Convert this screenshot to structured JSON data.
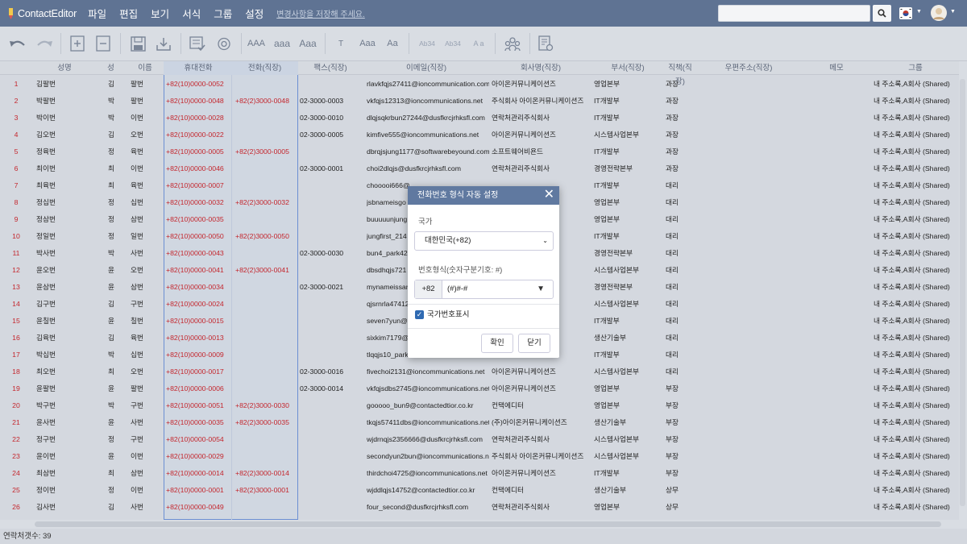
{
  "app": {
    "title": "ContactEditor",
    "warning": "변경사항을 저장해 주세요."
  },
  "menu": [
    "파일",
    "편집",
    "보기",
    "서식",
    "그룹",
    "설정"
  ],
  "search": {
    "placeholder": ""
  },
  "toolbar": {
    "font_upper": "AAA",
    "font_lower": "aaa",
    "font_title": "Aaa",
    "tt": "T",
    "aa1": "Aaa",
    "aa2": "Aa",
    "ab1": "Ab34",
    "ab2": "Ab34",
    "ab3": "A a"
  },
  "columns": [
    "성명",
    "성",
    "이름",
    "휴대전화",
    "전화(직장)",
    "팩스(직장)",
    "이메일(직장)",
    "회사명(직장)",
    "부서(직장)",
    "직책(직장)",
    "우편주소(직장)",
    "메모",
    "그룹"
  ],
  "rows": [
    {
      "n": "1",
      "name": "김팔번",
      "last": "김",
      "first": "팔번",
      "mobile": "+82(10)0000-0052",
      "work": "",
      "fax": "",
      "email": "rlavkfqjs27411@ioncommunication.com",
      "company": "아이온커뮤니케이션즈",
      "dept": "영업본부",
      "title": "과장",
      "group": "내 주소록,A회사 (Shared)"
    },
    {
      "n": "2",
      "name": "박팔번",
      "last": "박",
      "first": "팔번",
      "mobile": "+82(10)0000-0048",
      "work": "+82(2)3000-0048",
      "fax": "02-3000-0003",
      "email": "vkfqjs12313@ioncommunications.net",
      "company": "주식회사 아이온커뮤니케이션즈",
      "dept": "IT개발부",
      "title": "과장",
      "group": "내 주소록,A회사 (Shared)"
    },
    {
      "n": "3",
      "name": "박이번",
      "last": "박",
      "first": "이번",
      "mobile": "+82(10)0000-0028",
      "work": "",
      "fax": "02-3000-0010",
      "email": "dlqjsqkrbun27244@dusfkrcjrhksfl.com",
      "company": "연락처관리주식회사",
      "dept": "IT개발부",
      "title": "과장",
      "group": "내 주소록,A회사 (Shared)"
    },
    {
      "n": "4",
      "name": "김오번",
      "last": "김",
      "first": "오번",
      "mobile": "+82(10)0000-0022",
      "work": "",
      "fax": "02-3000-0005",
      "email": "kimfive555@ioncommunications.net",
      "company": "아이온커뮤니케이션즈",
      "dept": "시스템사업본부",
      "title": "과장",
      "group": "내 주소록,A회사 (Shared)"
    },
    {
      "n": "5",
      "name": "정육번",
      "last": "정",
      "first": "육번",
      "mobile": "+82(10)0000-0005",
      "work": "+82(2)3000-0005",
      "fax": "",
      "email": "dbrqjsjung1177@softwarebeyound.com",
      "company": "소프트웨어비욘드",
      "dept": "IT개발부",
      "title": "과장",
      "group": "내 주소록,A회사 (Shared)"
    },
    {
      "n": "6",
      "name": "최이번",
      "last": "최",
      "first": "이번",
      "mobile": "+82(10)0000-0046",
      "work": "",
      "fax": "02-3000-0001",
      "email": "choi2dlqjs@dusfkrcjrhksfl.com",
      "company": "연락처관리주식회사",
      "dept": "경영전략본부",
      "title": "과장",
      "group": "내 주소록,A회사 (Shared)"
    },
    {
      "n": "7",
      "name": "최육번",
      "last": "최",
      "first": "육번",
      "mobile": "+82(10)0000-0007",
      "work": "",
      "fax": "",
      "email": "chooooi666@",
      "company": "",
      "dept": "IT개발부",
      "title": "대리",
      "group": "내 주소록,A회사 (Shared)"
    },
    {
      "n": "8",
      "name": "정십번",
      "last": "정",
      "first": "십번",
      "mobile": "+82(10)0000-0032",
      "work": "+82(2)3000-0032",
      "fax": "",
      "email": "jsbnameisgo",
      "company": "",
      "dept": "영업본부",
      "title": "대리",
      "group": "내 주소록,A회사 (Shared)"
    },
    {
      "n": "9",
      "name": "정삼번",
      "last": "정",
      "first": "삼번",
      "mobile": "+82(10)0000-0035",
      "work": "",
      "fax": "",
      "email": "buuuuunjung",
      "company": "",
      "dept": "영업본부",
      "title": "대리",
      "group": "내 주소록,A회사 (Shared)"
    },
    {
      "n": "10",
      "name": "정일번",
      "last": "정",
      "first": "일번",
      "mobile": "+82(10)0000-0050",
      "work": "+82(2)3000-0050",
      "fax": "",
      "email": "jungfirst_214",
      "company": "",
      "dept": "IT개발부",
      "title": "대리",
      "group": "내 주소록,A회사 (Shared)"
    },
    {
      "n": "11",
      "name": "박사번",
      "last": "박",
      "first": "사번",
      "mobile": "+82(10)0000-0043",
      "work": "",
      "fax": "02-3000-0030",
      "email": "bun4_park42",
      "company": "",
      "dept": "경영전략본부",
      "title": "대리",
      "group": "내 주소록,A회사 (Shared)"
    },
    {
      "n": "12",
      "name": "윤오번",
      "last": "윤",
      "first": "오번",
      "mobile": "+82(10)0000-0041",
      "work": "+82(2)3000-0041",
      "fax": "",
      "email": "dbsdhqjs721",
      "company": "",
      "dept": "시스템사업본부",
      "title": "대리",
      "group": "내 주소록,A회사 (Shared)"
    },
    {
      "n": "13",
      "name": "윤삼번",
      "last": "윤",
      "first": "삼번",
      "mobile": "+82(10)0000-0034",
      "work": "",
      "fax": "02-3000-0021",
      "email": "mynameissar",
      "company": "",
      "dept": "경영전략본부",
      "title": "대리",
      "group": "내 주소록,A회사 (Shared)"
    },
    {
      "n": "14",
      "name": "김구번",
      "last": "김",
      "first": "구번",
      "mobile": "+82(10)0000-0024",
      "work": "",
      "fax": "",
      "email": "qjsrnrla47412",
      "company": "",
      "dept": "시스템사업본부",
      "title": "대리",
      "group": "내 주소록,A회사 (Shared)"
    },
    {
      "n": "15",
      "name": "윤칠번",
      "last": "윤",
      "first": "칠번",
      "mobile": "+82(10)0000-0015",
      "work": "",
      "fax": "",
      "email": "seven7yun@",
      "company": "",
      "dept": "IT개발부",
      "title": "대리",
      "group": "내 주소록,A회사 (Shared)"
    },
    {
      "n": "16",
      "name": "김육번",
      "last": "김",
      "first": "육번",
      "mobile": "+82(10)0000-0013",
      "work": "",
      "fax": "",
      "email": "sixkim7179@",
      "company": "",
      "dept": "생산기술부",
      "title": "대리",
      "group": "내 주소록,A회사 (Shared)"
    },
    {
      "n": "17",
      "name": "박십번",
      "last": "박",
      "first": "십번",
      "mobile": "+82(10)0000-0009",
      "work": "",
      "fax": "",
      "email": "tlqqjs10_park",
      "company": "",
      "dept": "IT개발부",
      "title": "대리",
      "group": "내 주소록,A회사 (Shared)"
    },
    {
      "n": "18",
      "name": "최오번",
      "last": "최",
      "first": "오번",
      "mobile": "+82(10)0000-0017",
      "work": "",
      "fax": "02-3000-0016",
      "email": "fivechoi2131@ioncommunications.net",
      "company": "아이온커뮤니케이션즈",
      "dept": "시스템사업본부",
      "title": "대리",
      "group": "내 주소록,A회사 (Shared)"
    },
    {
      "n": "19",
      "name": "윤팔번",
      "last": "윤",
      "first": "팔번",
      "mobile": "+82(10)0000-0006",
      "work": "",
      "fax": "02-3000-0014",
      "email": "vkfqjsdbs2745@ioncommunications.net",
      "company": "아이온커뮤니케이션즈",
      "dept": "영업본부",
      "title": "부장",
      "group": "내 주소록,A회사 (Shared)"
    },
    {
      "n": "20",
      "name": "박구번",
      "last": "박",
      "first": "구번",
      "mobile": "+82(10)0000-0051",
      "work": "+82(2)3000-0030",
      "fax": "",
      "email": "gooooo_bun9@contactedtior.co.kr",
      "company": "컨택에디터",
      "dept": "영업본부",
      "title": "부장",
      "group": "내 주소록,A회사 (Shared)"
    },
    {
      "n": "21",
      "name": "윤사번",
      "last": "윤",
      "first": "사번",
      "mobile": "+82(10)0000-0035",
      "work": "+82(2)3000-0035",
      "fax": "",
      "email": "tkqjs57411dbs@ioncommunications.net",
      "company": "(주)아이온커뮤니케이션즈",
      "dept": "생산기술부",
      "title": "부장",
      "group": "내 주소록,A회사 (Shared)"
    },
    {
      "n": "22",
      "name": "정구번",
      "last": "정",
      "first": "구번",
      "mobile": "+82(10)0000-0054",
      "work": "",
      "fax": "",
      "email": "wjdrnqjs2356666@dusfkrcjrhksfl.com",
      "company": "연락처관리주식회사",
      "dept": "시스템사업본부",
      "title": "부장",
      "group": "내 주소록,A회사 (Shared)"
    },
    {
      "n": "23",
      "name": "윤이번",
      "last": "윤",
      "first": "이번",
      "mobile": "+82(10)0000-0029",
      "work": "",
      "fax": "",
      "email": "secondyun2bun@ioncommunications.net",
      "company": "주식회사 아이온커뮤니케이션즈",
      "dept": "시스템사업본부",
      "title": "부장",
      "group": "내 주소록,A회사 (Shared)"
    },
    {
      "n": "24",
      "name": "최삼번",
      "last": "최",
      "first": "삼번",
      "mobile": "+82(10)0000-0014",
      "work": "+82(2)3000-0014",
      "fax": "",
      "email": "thirdchoi4725@ioncommunications.net",
      "company": "아이온커뮤니케이션즈",
      "dept": "IT개발부",
      "title": "부장",
      "group": "내 주소록,A회사 (Shared)"
    },
    {
      "n": "25",
      "name": "정이번",
      "last": "정",
      "first": "이번",
      "mobile": "+82(10)0000-0001",
      "work": "+82(2)3000-0001",
      "fax": "",
      "email": "wjddlqjs14752@contactedtior.co.kr",
      "company": "컨택에디터",
      "dept": "생산기술부",
      "title": "상무",
      "group": "내 주소록,A회사 (Shared)"
    },
    {
      "n": "26",
      "name": "김사번",
      "last": "김",
      "first": "사번",
      "mobile": "+82(10)0000-0049",
      "work": "",
      "fax": "",
      "email": "four_second@dusfkrcjrhksfl.com",
      "company": "연락처관리주식회사",
      "dept": "영업본부",
      "title": "상무",
      "group": "내 주소록,A회사 (Shared)"
    }
  ],
  "status": {
    "text": "연락처갯수: 39"
  },
  "dialog": {
    "title": "전화번호 형식 자동 설정",
    "country_label": "국가",
    "country_value": "대한민국(+82)",
    "format_label": "번호형식(숫자구분기호: #)",
    "prefix": "+82",
    "format_value": "(#)#-#",
    "checkbox_label": "국가번호표시",
    "checkbox_checked": true,
    "ok": "확인",
    "close": "닫기"
  }
}
